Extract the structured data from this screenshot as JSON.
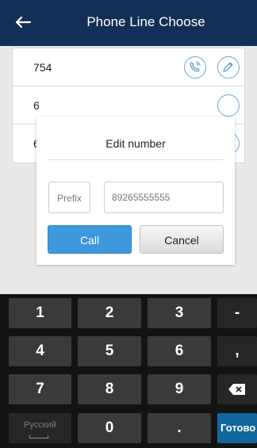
{
  "header": {
    "title": "Phone Line Choose",
    "back_icon": "arrow-left-icon"
  },
  "list": {
    "rows": [
      {
        "number": "754"
      },
      {
        "number": "6"
      },
      {
        "number": "6"
      }
    ],
    "call_icon": "phone-icon",
    "edit_icon": "pencil-icon",
    "accent_color": "#6aa7da"
  },
  "dialog": {
    "title": "Edit number",
    "prefix_label": "Prefix",
    "number_placeholder": "89265555555",
    "call_label": "Call",
    "cancel_label": "Cancel",
    "call_color": "#3f98dc"
  },
  "keyboard": {
    "rows": [
      [
        "1",
        "2",
        "3",
        "-"
      ],
      [
        "4",
        "5",
        "6",
        ","
      ],
      [
        "7",
        "8",
        "9",
        "backspace"
      ],
      [
        "Русский",
        "0",
        ".",
        "Готово"
      ]
    ],
    "backspace_icon": "backspace-icon",
    "lang_label": "Русский",
    "done_label": "Готово",
    "done_color": "#11679d"
  }
}
